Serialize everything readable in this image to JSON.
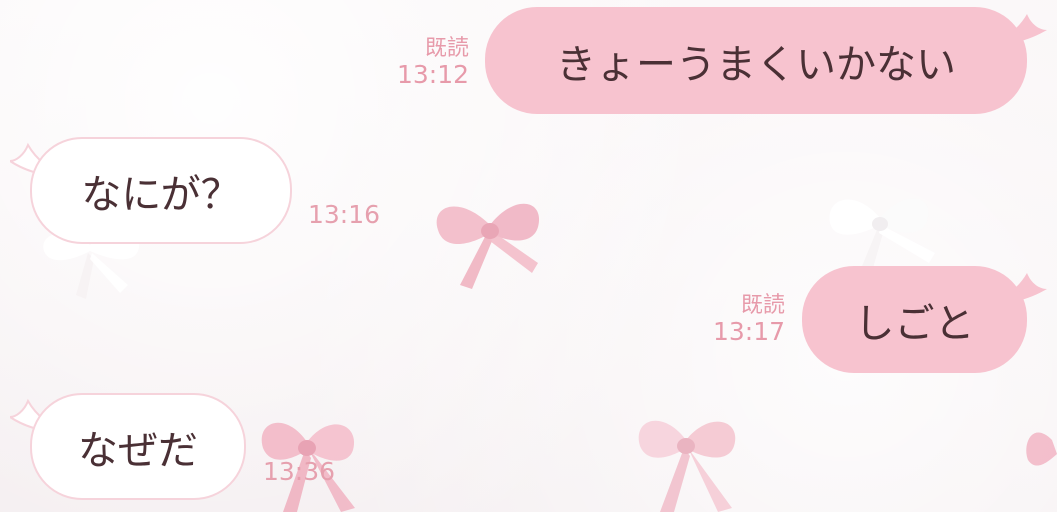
{
  "colors": {
    "sent_bubble": "#f7c3cf",
    "recv_bubble": "#ffffff",
    "meta_text": "#e79aaa",
    "message_text": "#4a3035"
  },
  "messages": [
    {
      "direction": "sent",
      "text": "きょーうまくいかない",
      "read_label": "既読",
      "time": "13:12"
    },
    {
      "direction": "received",
      "text": "なにが？",
      "time": "13:16"
    },
    {
      "direction": "sent",
      "text": "しごと",
      "read_label": "既読",
      "time": "13:17"
    },
    {
      "direction": "received",
      "text": "なぜだ",
      "time": "13:36"
    }
  ],
  "background": {
    "decoration_icon": "ribbon-bow-icon"
  }
}
